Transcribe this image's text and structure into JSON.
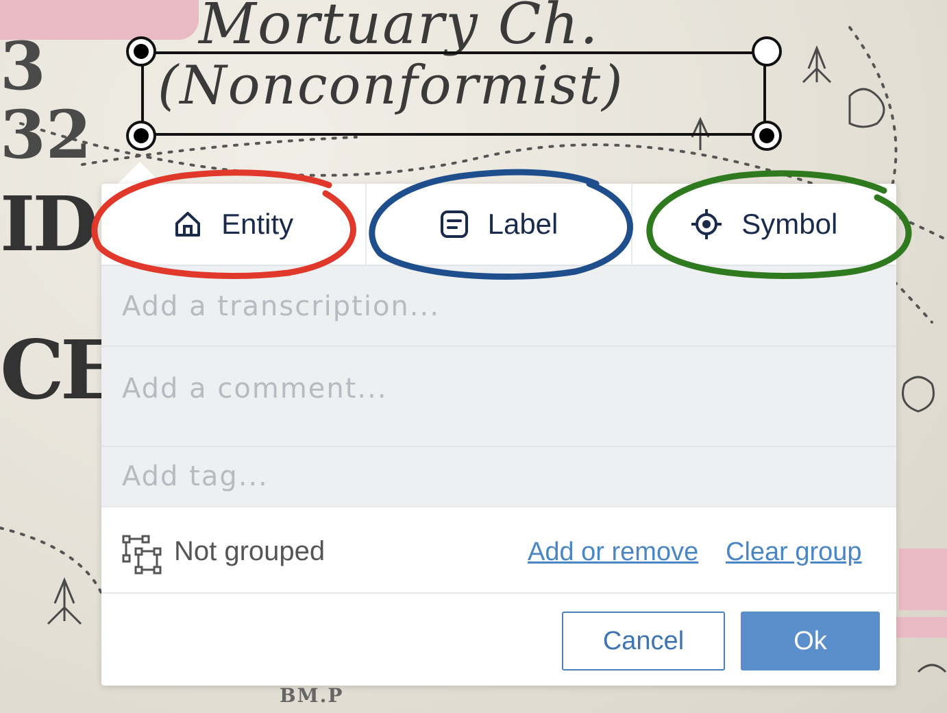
{
  "map": {
    "title_line1": "Mortuary Ch.",
    "title_line2": "(Nonconformist)",
    "digits_top": "3",
    "digits_mid": "32",
    "letters_left_1": "ID",
    "letters_left_2": "CE",
    "bottom_text": "BM.P"
  },
  "tabs": [
    {
      "label": "Entity",
      "icon": "home-icon"
    },
    {
      "label": "Label",
      "icon": "note-icon"
    },
    {
      "label": "Symbol",
      "icon": "target-icon"
    }
  ],
  "fields": {
    "transcription_placeholder": "Add a transcription...",
    "comment_placeholder": "Add a comment...",
    "tag_placeholder": "Add tag..."
  },
  "grouping": {
    "status": "Not grouped",
    "add_or_remove": "Add or remove",
    "clear_group": "Clear group"
  },
  "buttons": {
    "cancel": "Cancel",
    "ok": "Ok"
  },
  "colors": {
    "entity_highlight": "#e0392b",
    "label_highlight": "#1f4e8c",
    "symbol_highlight": "#2f7a1f",
    "link": "#4b86c4",
    "primary": "#5b8fcc"
  }
}
